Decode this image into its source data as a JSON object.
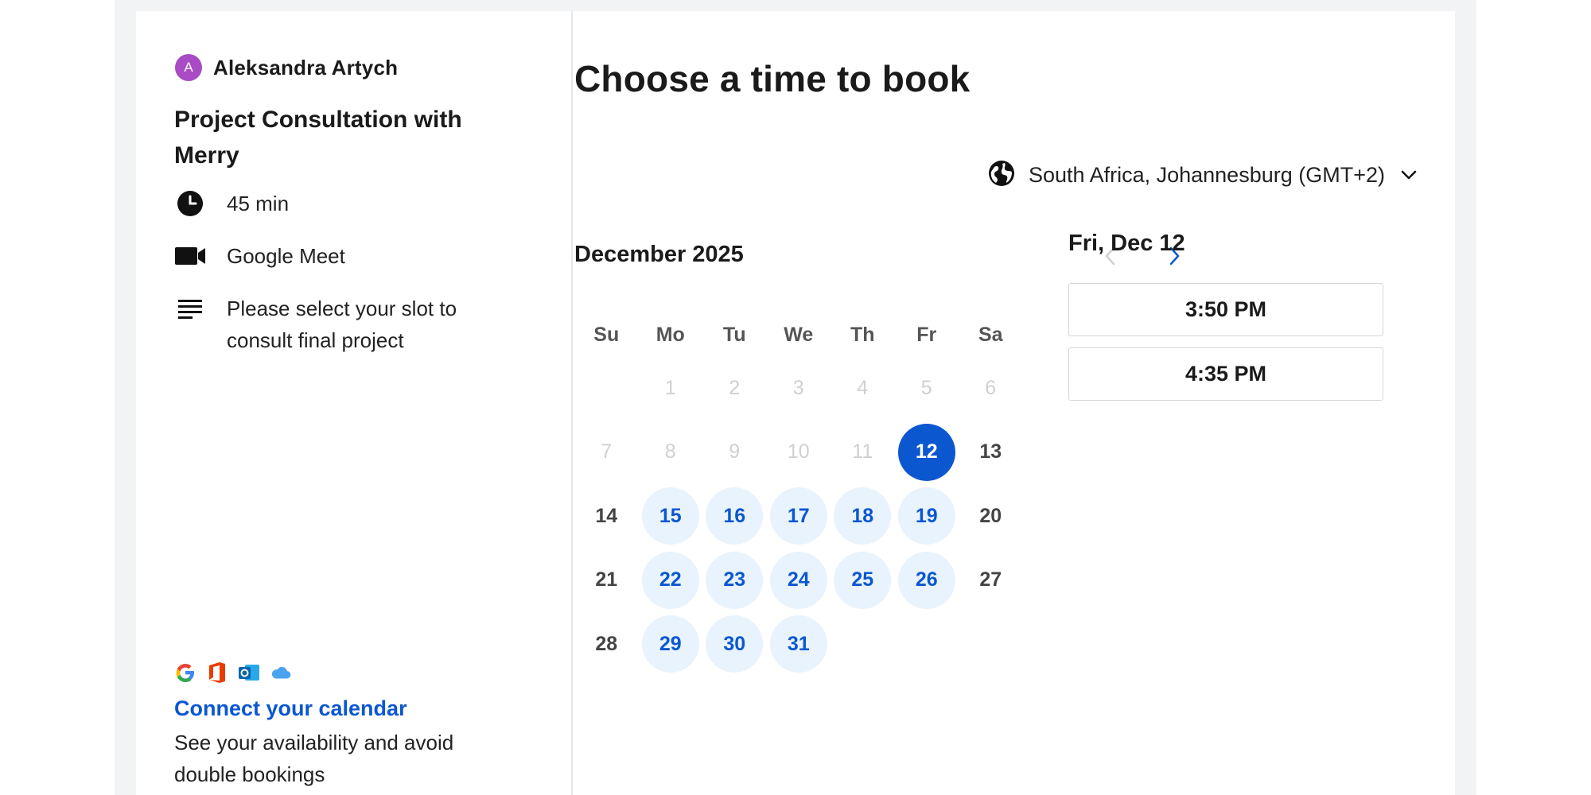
{
  "host": {
    "avatar_initial": "A",
    "name": "Aleksandra Artych",
    "avatar_color": "#a84bc5"
  },
  "event": {
    "title": "Project Consultation with Merry",
    "duration": "45 min",
    "location": "Google Meet",
    "description": "Please select your slot to consult final project"
  },
  "calendar_connect": {
    "icons": [
      "google-icon",
      "office-icon",
      "outlook-icon",
      "icloud-icon"
    ],
    "link_label": "Connect your calendar",
    "subtext": "See your availability and avoid double bookings"
  },
  "booking": {
    "title": "Choose a time to book",
    "timezone": "South Africa, Johannesburg (GMT+2)",
    "month_label": "December 2025",
    "weekdays": [
      "Su",
      "Mo",
      "Tu",
      "We",
      "Th",
      "Fr",
      "Sa"
    ],
    "weeks": [
      [
        {
          "d": ""
        },
        {
          "d": "1",
          "s": "disabled"
        },
        {
          "d": "2",
          "s": "disabled"
        },
        {
          "d": "3",
          "s": "disabled"
        },
        {
          "d": "4",
          "s": "disabled"
        },
        {
          "d": "5",
          "s": "disabled"
        },
        {
          "d": "6",
          "s": "disabled"
        }
      ],
      [
        {
          "d": "7",
          "s": "disabled"
        },
        {
          "d": "8",
          "s": "disabled"
        },
        {
          "d": "9",
          "s": "disabled"
        },
        {
          "d": "10",
          "s": "disabled"
        },
        {
          "d": "11",
          "s": "disabled"
        },
        {
          "d": "12",
          "s": "selected"
        },
        {
          "d": "13",
          "s": "inactive"
        }
      ],
      [
        {
          "d": "14",
          "s": "inactive"
        },
        {
          "d": "15",
          "s": "available"
        },
        {
          "d": "16",
          "s": "available"
        },
        {
          "d": "17",
          "s": "available"
        },
        {
          "d": "18",
          "s": "available"
        },
        {
          "d": "19",
          "s": "available"
        },
        {
          "d": "20",
          "s": "inactive"
        }
      ],
      [
        {
          "d": "21",
          "s": "inactive"
        },
        {
          "d": "22",
          "s": "available"
        },
        {
          "d": "23",
          "s": "available"
        },
        {
          "d": "24",
          "s": "available"
        },
        {
          "d": "25",
          "s": "available"
        },
        {
          "d": "26",
          "s": "available"
        },
        {
          "d": "27",
          "s": "inactive"
        }
      ],
      [
        {
          "d": "28",
          "s": "inactive"
        },
        {
          "d": "29",
          "s": "available"
        },
        {
          "d": "30",
          "s": "available"
        },
        {
          "d": "31",
          "s": "available"
        },
        {
          "d": ""
        },
        {
          "d": ""
        },
        {
          "d": ""
        }
      ]
    ],
    "selected_date": "Fri, Dec 12",
    "time_slots": [
      "3:50 PM",
      "4:35 PM"
    ]
  },
  "colors": {
    "accent": "#0b57d0",
    "available_bg": "#e8f3fe",
    "disabled_text": "#d0d0d3"
  }
}
